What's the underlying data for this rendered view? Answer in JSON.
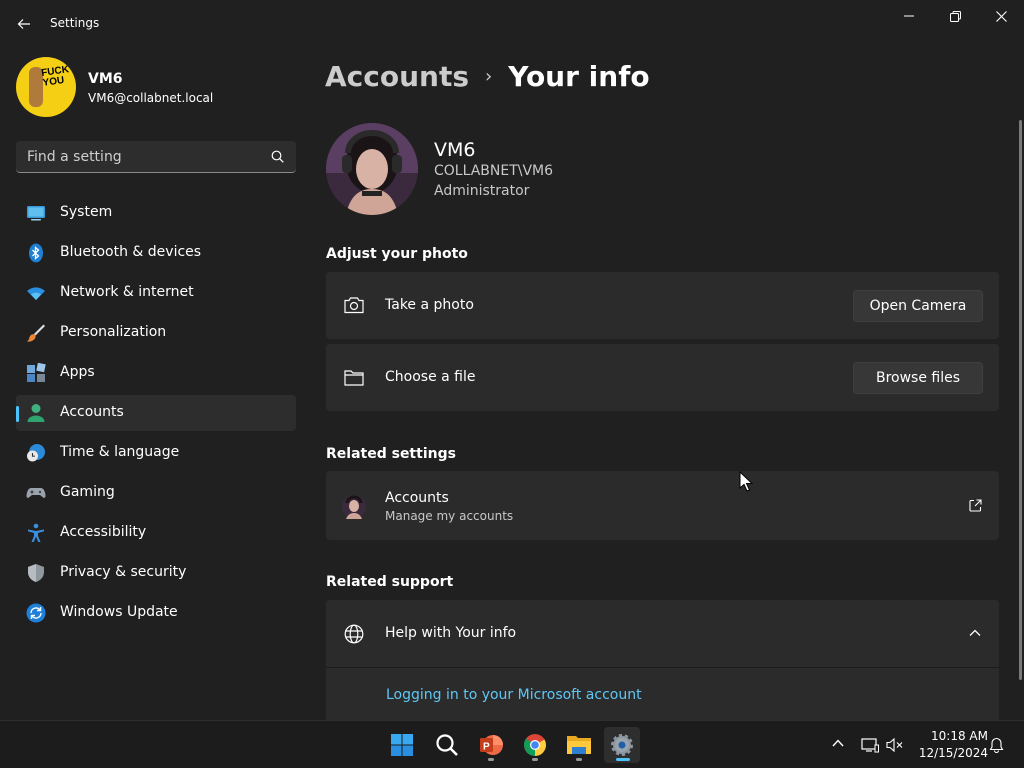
{
  "window": {
    "title": "Settings"
  },
  "profile": {
    "name": "VM6",
    "email": "VM6@collabnet.local",
    "sticker_text": "FUCK YOU"
  },
  "search": {
    "placeholder": "Find a setting"
  },
  "nav": [
    {
      "label": "System",
      "icon": "system-icon"
    },
    {
      "label": "Bluetooth & devices",
      "icon": "bluetooth-icon"
    },
    {
      "label": "Network & internet",
      "icon": "wifi-icon"
    },
    {
      "label": "Personalization",
      "icon": "brush-icon"
    },
    {
      "label": "Apps",
      "icon": "apps-icon"
    },
    {
      "label": "Accounts",
      "icon": "accounts-icon",
      "selected": true
    },
    {
      "label": "Time & language",
      "icon": "clock-globe-icon"
    },
    {
      "label": "Gaming",
      "icon": "gamepad-icon"
    },
    {
      "label": "Accessibility",
      "icon": "accessibility-icon"
    },
    {
      "label": "Privacy & security",
      "icon": "shield-icon"
    },
    {
      "label": "Windows Update",
      "icon": "update-icon"
    }
  ],
  "breadcrumb": {
    "parent": "Accounts",
    "separator": "›",
    "current": "Your info"
  },
  "user": {
    "name": "VM6",
    "domain": "COLLABNET\\VM6",
    "role": "Administrator"
  },
  "adjust_photo": {
    "title": "Adjust your photo",
    "take_photo": {
      "label": "Take a photo",
      "button": "Open Camera"
    },
    "choose_file": {
      "label": "Choose a file",
      "button": "Browse files"
    }
  },
  "related_settings": {
    "title": "Related settings",
    "accounts": {
      "label": "Accounts",
      "sublabel": "Manage my accounts"
    }
  },
  "related_support": {
    "title": "Related support",
    "help": {
      "label": "Help with Your info",
      "link": "Logging in to your Microsoft account"
    }
  },
  "taskbar": {
    "apps": [
      "start-icon",
      "search-icon",
      "powerpoint-icon",
      "chrome-icon",
      "file-explorer-icon",
      "settings-icon"
    ],
    "time": "10:18 AM",
    "date": "12/15/2024"
  },
  "colors": {
    "accent": "#4cc2ff",
    "link": "#5fc7f5",
    "background": "#202020",
    "card": "#2b2b2b"
  }
}
